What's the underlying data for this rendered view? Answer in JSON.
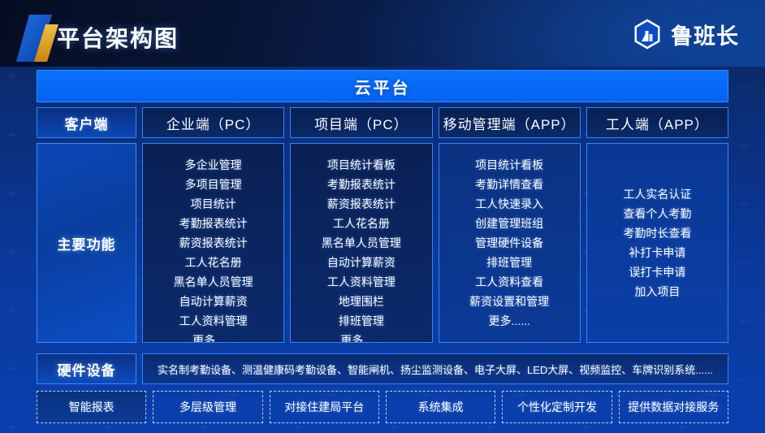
{
  "header": {
    "title": "平台架构图",
    "logo_text": "鲁班长",
    "logo_icon": "hexagon-building-icon",
    "brand_slash_icon": "brand-slash-icon",
    "colors": {
      "brand_blue": "#0a6cf5",
      "brand_gold": "#e0a321",
      "dark_navy": "#0a1228"
    }
  },
  "banner": {
    "label": "云平台"
  },
  "rows": {
    "client_label": "客户端",
    "functions_label": "主要功能",
    "hardware_label": "硬件设备"
  },
  "columns": [
    {
      "tab": "企业端（PC）",
      "items": [
        "多企业管理",
        "多项目管理",
        "项目统计",
        "考勤报表统计",
        "薪资报表统计",
        "工人花名册",
        "黑名单人员管理",
        "自动计算薪资",
        "工人资料管理",
        "更多......"
      ]
    },
    {
      "tab": "项目端（PC）",
      "items": [
        "项目统计看板",
        "考勤报表统计",
        "薪资报表统计",
        "工人花名册",
        "黑名单人员管理",
        "自动计算薪资",
        "工人资料管理",
        "地理围栏",
        "排班管理",
        "更多......"
      ]
    },
    {
      "tab": "移动管理端（APP）",
      "items": [
        "项目统计看板",
        "考勤详情查看",
        "工人快速录入",
        "创建管理班组",
        "管理硬件设备",
        "排班管理",
        "工人资料查看",
        "薪资设置和管理",
        "更多......"
      ]
    },
    {
      "tab": "工人端（APP）",
      "items": [
        "工人实名认证",
        "查看个人考勤",
        "考勤时长查看",
        "补打卡申请",
        "误打卡申请",
        "加入项目"
      ]
    }
  ],
  "hardware": {
    "text": "实名制考勤设备、测温健康码考勤设备、智能闸机、扬尘监测设备、电子大屏、LED大屏、视频监控、车牌识别系统......"
  },
  "chips": [
    "智能报表",
    "多层级管理",
    "对接住建局平台",
    "系统集成",
    "个性化定制开发",
    "提供数据对接服务"
  ]
}
